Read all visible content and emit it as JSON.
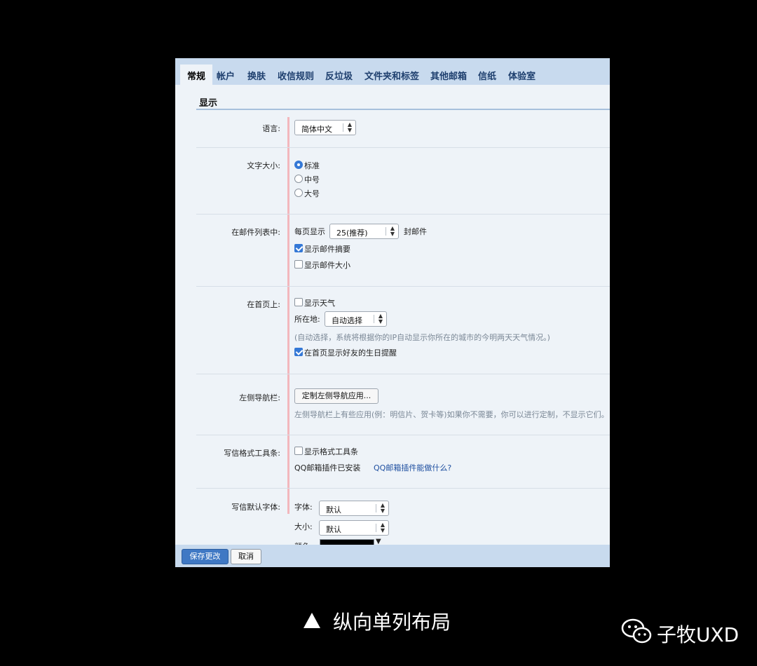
{
  "tabs": [
    "常规",
    "帐户",
    "换肤",
    "收信规则",
    "反垃圾",
    "文件夹和标签",
    "其他邮箱",
    "信纸",
    "体验室"
  ],
  "section_title": "显示",
  "language": {
    "label": "语言:",
    "value": "简体中文"
  },
  "font_size": {
    "label": "文字大小:",
    "options": [
      "标准",
      "中号",
      "大号"
    ],
    "selected": "标准"
  },
  "mail_list": {
    "label": "在邮件列表中:",
    "per_page_prefix": "每页显示",
    "per_page_value": "25(推荐)",
    "per_page_suffix": "封邮件",
    "show_summary": {
      "text": "显示邮件摘要",
      "checked": true
    },
    "show_size": {
      "text": "显示邮件大小",
      "checked": false
    }
  },
  "home": {
    "label": "在首页上:",
    "show_weather": {
      "text": "显示天气",
      "checked": false
    },
    "location_label": "所在地:",
    "location_value": "自动选择",
    "note": "(自动选择，系统将根据你的IP自动显示你所在的城市的今明两天天气情况。)",
    "birthday": {
      "text": "在首页显示好友的生日提醒",
      "checked": true
    }
  },
  "left_nav": {
    "label": "左侧导航栏:",
    "button": "定制左侧导航应用...",
    "note": "左侧导航栏上有些应用(例：明信片、贺卡等)如果你不需要，你可以进行定制，不显示它们。"
  },
  "toolbar": {
    "label": "写信格式工具条:",
    "show_toolbar": {
      "text": "显示格式工具条",
      "checked": false
    },
    "plugin_status": "QQ邮箱插件已安装",
    "plugin_link": "QQ邮箱插件能做什么?"
  },
  "default_font": {
    "label": "写信默认字体:",
    "font_label": "字体:",
    "font_value": "默认",
    "size_label": "大小:",
    "size_value": "默认",
    "color_label": "颜色:"
  },
  "footer": {
    "save": "保存更改",
    "cancel": "取消"
  },
  "caption": {
    "triangle": "▲",
    "text": "纵向单列布局"
  },
  "watermark": {
    "icon": "wechat-icon",
    "text": "子牧UXD"
  },
  "colors": {
    "accent": "#3478d6",
    "tab_bar": "#c8daee",
    "panel": "#eef3f8",
    "guide_line": "#f3b7bd",
    "primary_button": "#3f78c4"
  }
}
